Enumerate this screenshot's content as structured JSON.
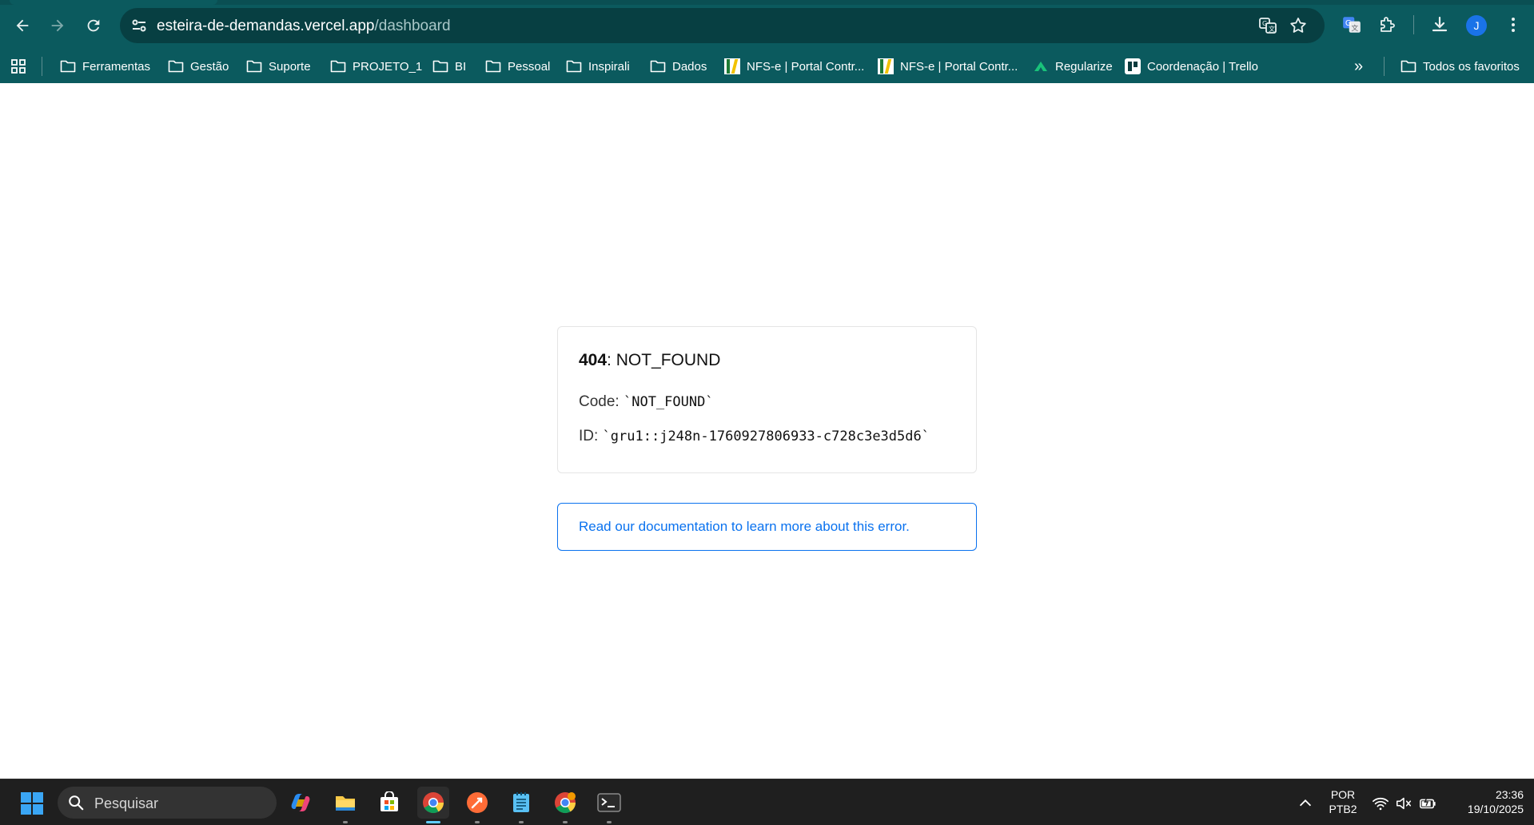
{
  "browser": {
    "url_host": "esteira-de-demandas.vercel.app",
    "url_path": "/dashboard",
    "profile_initial": "J",
    "icons": [
      "back-icon",
      "forward-icon",
      "reload-icon",
      "site-settings-icon",
      "translate-icon",
      "star-icon",
      "google-translate-extension-icon",
      "extensions-icon",
      "download-icon",
      "menu-icon"
    ]
  },
  "bookmarks": {
    "items": [
      {
        "label": "Ferramentas",
        "type": "folder"
      },
      {
        "label": "Gestão",
        "type": "folder"
      },
      {
        "label": "Suporte",
        "type": "folder"
      },
      {
        "label": "PROJETO_1",
        "type": "folder"
      },
      {
        "label": "BI",
        "type": "folder"
      },
      {
        "label": "Pessoal",
        "type": "folder"
      },
      {
        "label": "Inspirali",
        "type": "folder"
      },
      {
        "label": "Dados",
        "type": "folder"
      },
      {
        "label": "NFS-e | Portal Contr...",
        "type": "site"
      },
      {
        "label": "NFS-e | Portal Contr...",
        "type": "site"
      },
      {
        "label": "Regularize",
        "type": "site"
      },
      {
        "label": "Coordenação | Trello",
        "type": "site"
      }
    ],
    "overflow_label": "»",
    "all_bookmarks_label": "Todos os favoritos"
  },
  "error": {
    "status_code": "404",
    "status_text": ": NOT_FOUND",
    "code_label": "Code:",
    "code_value": "`NOT_FOUND`",
    "id_label": "ID:",
    "id_value": "`gru1::j248n-1760927806933-c728c3e3d5d6`",
    "doc_link": "Read our documentation to learn more about this error."
  },
  "taskbar": {
    "search_placeholder": "Pesquisar",
    "apps": [
      "copilot-icon",
      "file-explorer-icon",
      "microsoft-store-icon",
      "chrome-icon",
      "postman-icon",
      "notepad-icon",
      "chrome-badge-icon",
      "terminal-icon"
    ],
    "lang_line1": "POR",
    "lang_line2": "PTB2",
    "time": "23:36",
    "date": "19/10/2025"
  },
  "colors": {
    "chrome_frame": "#0b5a5e",
    "omnibox": "#073f42",
    "link_blue": "#0a72ef",
    "taskbar": "#1f1f1f"
  }
}
